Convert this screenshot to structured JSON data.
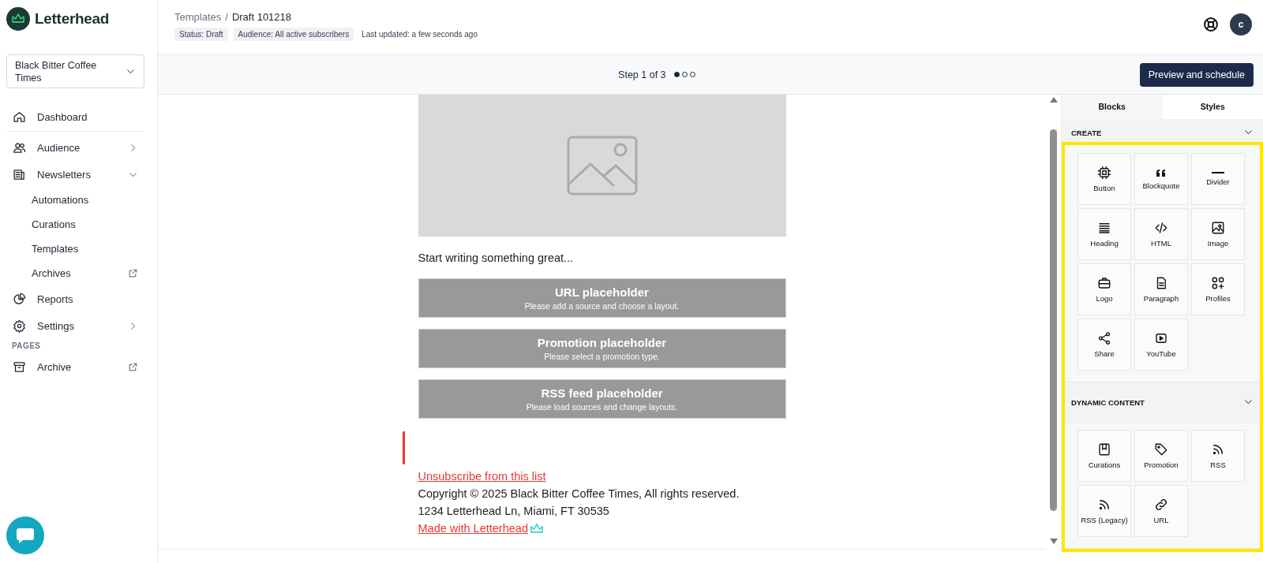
{
  "brand": {
    "name": "Letterhead"
  },
  "publication_select": {
    "value": "Black Bitter Coffee Times"
  },
  "nav": [
    {
      "kind": "item",
      "label": "Dashboard"
    },
    {
      "kind": "group",
      "label": "Audience",
      "expanded": false
    },
    {
      "kind": "group",
      "label": "Newsletters",
      "expanded": true,
      "children": [
        {
          "label": "Automations",
          "external": false
        },
        {
          "label": "Curations",
          "external": false
        },
        {
          "label": "Templates",
          "external": false
        },
        {
          "label": "Archives",
          "external": true
        }
      ]
    },
    {
      "kind": "item",
      "label": "Reports"
    },
    {
      "kind": "group",
      "label": "Settings",
      "expanded": false
    },
    {
      "kind": "heading",
      "label": "PAGES"
    },
    {
      "kind": "item",
      "label": "Archive",
      "external": true
    }
  ],
  "header": {
    "breadcrumb": [
      "Templates",
      "Draft 101218"
    ],
    "separator": "/",
    "tags": [
      "Status: Draft",
      "Audience: All active subscribers"
    ],
    "last_updated": "Last updated: a few seconds ago",
    "avatar": "c"
  },
  "step_bar": {
    "label": "Step 1 of 3",
    "steps": [
      {
        "selected": true
      },
      {
        "selected": false
      },
      {
        "selected": false
      }
    ],
    "button": "Preview and schedule"
  },
  "canvas": {
    "intro": "Start writing something great...",
    "placeholders": [
      {
        "title": "URL placeholder",
        "subtitle": "Please add a source and choose a layout."
      },
      {
        "title": "Promotion placeholder",
        "subtitle": "Please select a promotion type."
      },
      {
        "title": "RSS feed placeholder",
        "subtitle": "Please load sources and change layouts."
      }
    ],
    "footer": {
      "unsubscribe": "Unsubscribe from this list",
      "copyright": "Copyright © 2025 Black Bitter Coffee Times, All rights reserved.",
      "address": "1234 Letterhead Ln, Miami, FT 30535",
      "made_with": "Made with Letterhead"
    }
  },
  "blocks_panel": {
    "highlighted": true,
    "tabs": [
      {
        "label": "Blocks",
        "selected": true
      },
      {
        "label": "Styles",
        "selected": false
      }
    ],
    "sections": [
      {
        "title": "CREATE",
        "expanded": true,
        "blocks": [
          "Button",
          "Blockquote",
          "Divider",
          "Heading",
          "HTML",
          "Image",
          "Logo",
          "Paragraph",
          "Profiles",
          "Share",
          "YouTube"
        ]
      },
      {
        "title": "DYNAMIC CONTENT",
        "expanded": true,
        "blocks": [
          "Curations",
          "Promotion",
          "RSS",
          "RSS (Legacy)",
          "URL"
        ]
      }
    ]
  }
}
